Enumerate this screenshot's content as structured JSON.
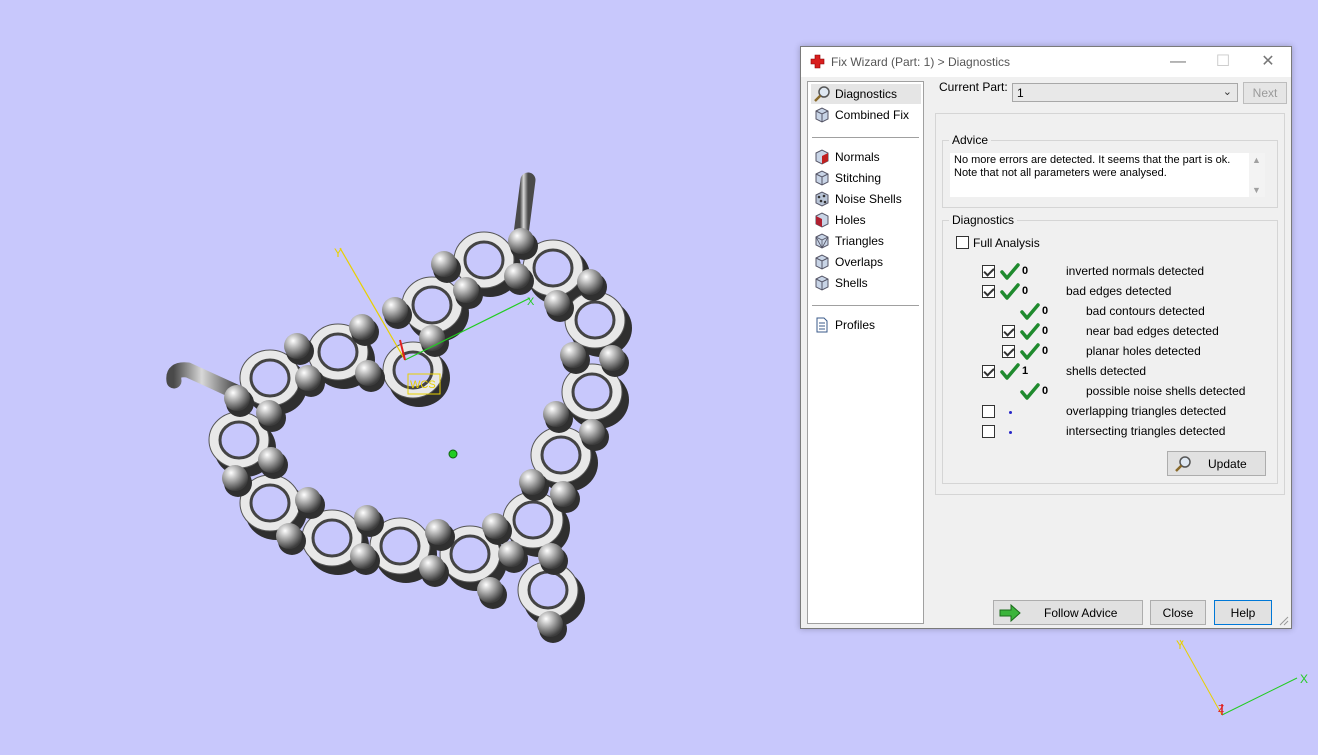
{
  "window": {
    "title": "Fix Wizard (Part: 1) > Diagnostics",
    "controls": {
      "minimize": "—",
      "maximize": "☐",
      "close": "✕"
    }
  },
  "nav": {
    "items_top": [
      {
        "label": "Diagnostics",
        "icon": "magnifier-icon"
      },
      {
        "label": "Combined Fix",
        "icon": "cube-icon"
      }
    ],
    "items_mid": [
      {
        "label": "Normals",
        "icon": "normals-cube-icon"
      },
      {
        "label": "Stitching",
        "icon": "stitching-cube-icon"
      },
      {
        "label": "Noise Shells",
        "icon": "noise-shells-icon"
      },
      {
        "label": "Holes",
        "icon": "holes-cube-icon"
      },
      {
        "label": "Triangles",
        "icon": "triangles-cube-icon"
      },
      {
        "label": "Overlaps",
        "icon": "overlaps-cube-icon"
      },
      {
        "label": "Shells",
        "icon": "shells-cube-icon"
      }
    ],
    "items_bottom": [
      {
        "label": "Profiles",
        "icon": "document-icon"
      }
    ]
  },
  "current_part": {
    "label": "Current Part:",
    "value": "1"
  },
  "next_label": "Next",
  "advice": {
    "title": "Advice",
    "text": "No more errors are detected. It seems that the part is ok.\nNote that not all parameters were analysed."
  },
  "diagnostics": {
    "title": "Diagnostics",
    "full_analysis": {
      "label": "Full Analysis",
      "checked": false
    },
    "rows": [
      {
        "checked": true,
        "status": "ok",
        "count": "0",
        "label": "inverted normals detected",
        "level": 0
      },
      {
        "checked": true,
        "status": "ok",
        "count": "0",
        "label": "bad edges detected",
        "level": 0
      },
      {
        "checked": null,
        "status": "ok",
        "count": "0",
        "label": "bad contours detected",
        "level": 1
      },
      {
        "checked": true,
        "status": "ok",
        "count": "0",
        "label": "near bad edges detected",
        "level": 1
      },
      {
        "checked": true,
        "status": "ok",
        "count": "0",
        "label": "planar holes detected",
        "level": 1
      },
      {
        "checked": true,
        "status": "ok",
        "count": "1",
        "label": "shells detected",
        "level": 0
      },
      {
        "checked": null,
        "status": "ok",
        "count": "0",
        "label": "possible noise shells detected",
        "level": 1
      },
      {
        "checked": false,
        "status": "pending",
        "count": "",
        "label": "overlapping triangles detected",
        "level": 0
      },
      {
        "checked": false,
        "status": "pending",
        "count": "",
        "label": "intersecting triangles detected",
        "level": 0
      }
    ],
    "update_label": "Update"
  },
  "buttons": {
    "follow_advice": "Follow Advice",
    "close": "Close",
    "help": "Help"
  },
  "viewport": {
    "wcs_label": "WCS",
    "axes": {
      "x": "X",
      "y": "Y",
      "z": "Z"
    },
    "colors": {
      "background": "#c8c8fc",
      "x_axis": "#22cc22",
      "y_axis": "#e8d000",
      "z_axis": "#e02020"
    }
  }
}
